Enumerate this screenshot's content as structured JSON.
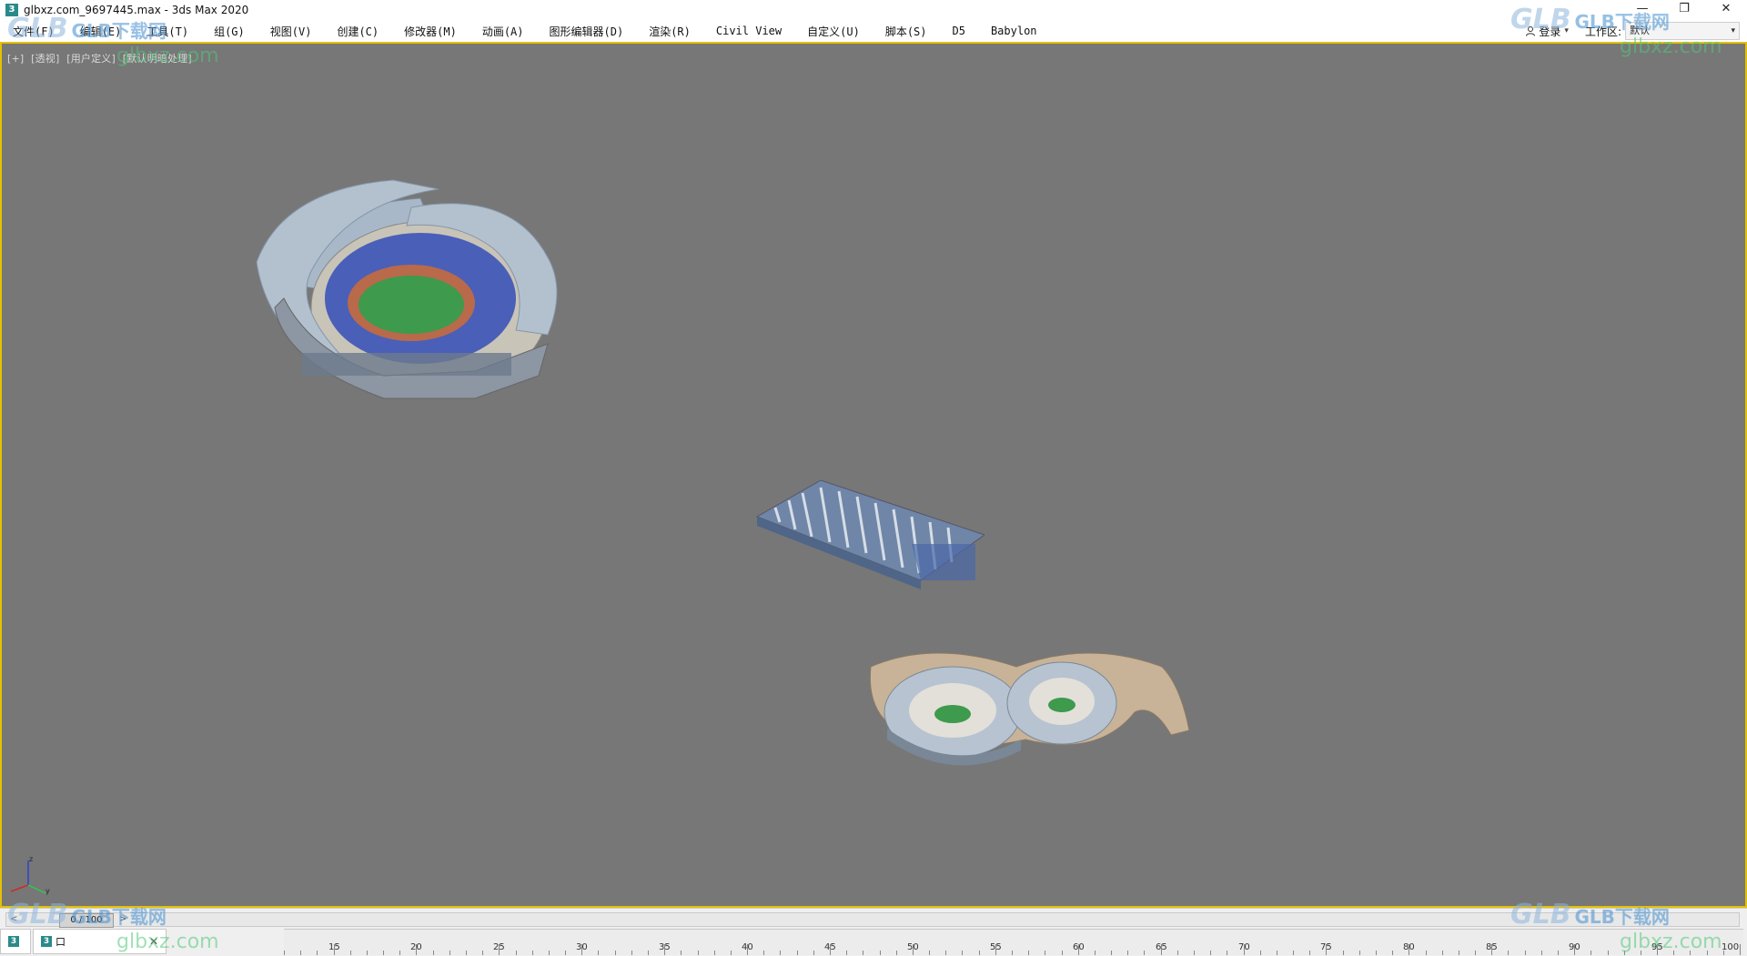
{
  "window": {
    "title": "glbxz.com_9697445.max - 3ds Max 2020",
    "app_icon": "3",
    "controls": [
      "—",
      "❐",
      "✕"
    ]
  },
  "menubar": {
    "items": [
      "文件(F)",
      "编辑(E)",
      "工具(T)",
      "组(G)",
      "视图(V)",
      "创建(C)",
      "修改器(M)",
      "动画(A)",
      "图形编辑器(D)",
      "渲染(R)",
      "Civil View",
      "自定义(U)",
      "脚本(S)",
      "D5",
      "Babylon"
    ],
    "signin_label": "登录",
    "workspace_label": "工作区:",
    "workspace_value": "默认"
  },
  "viewport": {
    "labels": [
      "[+]",
      "[透视]",
      "[用户定义]",
      "[默认明暗处理]"
    ],
    "background": "#777777",
    "active_border": "#e5c100"
  },
  "timeline": {
    "thumb_label": "0 / 100",
    "prev_arrow": "<",
    "next_arrow": ">",
    "ticks": [
      "15",
      "20",
      "25",
      "30",
      "35",
      "40",
      "45",
      "50",
      "55",
      "60",
      "65",
      "70",
      "75",
      "80",
      "85",
      "90",
      "95",
      "100"
    ]
  },
  "tabs": [
    {
      "icon": "3",
      "label": ""
    },
    {
      "icon": "3",
      "label": "口"
    }
  ],
  "tab_close": "✕",
  "watermark": {
    "logo": "GLB",
    "cn": "GLB下载网",
    "url": "glbxz.com"
  }
}
